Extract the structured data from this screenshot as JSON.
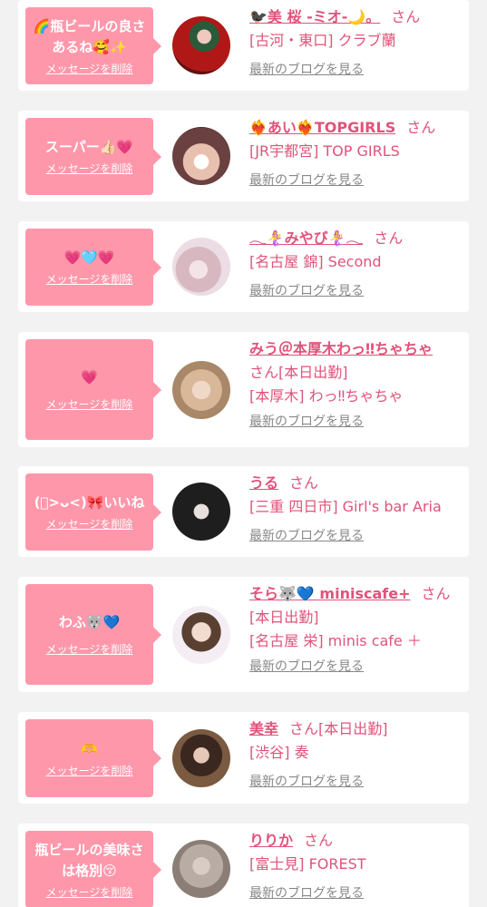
{
  "ui": {
    "delete_label": "メッセージを削除",
    "blog_label": "最新のブログを見る",
    "san": "さん",
    "colors": {
      "accent": "#e0537a",
      "bubble": "#ff97ab",
      "background": "#f2f2f2",
      "link_gray": "#888888"
    }
  },
  "entries": [
    {
      "message": "🌈瓶ビールの良さ\nあるね🥰✨",
      "name": "🐦‍⬛美 桜 -ミオ-🌙。",
      "sub": [
        "[古河・東口] クラブ蘭"
      ]
    },
    {
      "message": "スーパー👍🏻💗",
      "name": "❤️‍🔥あい❤️‍🔥TOPGIRLS",
      "sub": [
        "[JR宇都宮] TOP GIRLS"
      ]
    },
    {
      "message": "💗🩵💗",
      "name": "𓂃🧜‍♀️みやび🧜‍♀️𓂃",
      "sub": [
        "[名古屋 錦] Second"
      ]
    },
    {
      "message": "💗",
      "name": "みう＠本厚木わっ‼︎ちゃちゃ",
      "sub": [
        "[本日出勤]",
        "[本厚木] わっ‼︎ちゃちゃ"
      ]
    },
    {
      "message": "(ﾟ>ᴗ<)🎀いいね",
      "name": "うる",
      "sub": [
        "[三重 四日市] Girl's bar Aria"
      ]
    },
    {
      "message": "わふ🐺💙",
      "name": "そら🐺💙 miniscafe+",
      "sub": [
        "[本日出勤]",
        "[名古屋 栄] minis cafe ＋"
      ]
    },
    {
      "message": "🫶",
      "name": "美幸",
      "sub": [
        "[本日出勤]",
        "[渋谷] 奏"
      ]
    },
    {
      "message": "瓶ビールの美味さ\nは格別😚",
      "name": "りりか",
      "sub": [
        "[富士見] FOREST"
      ]
    }
  ]
}
